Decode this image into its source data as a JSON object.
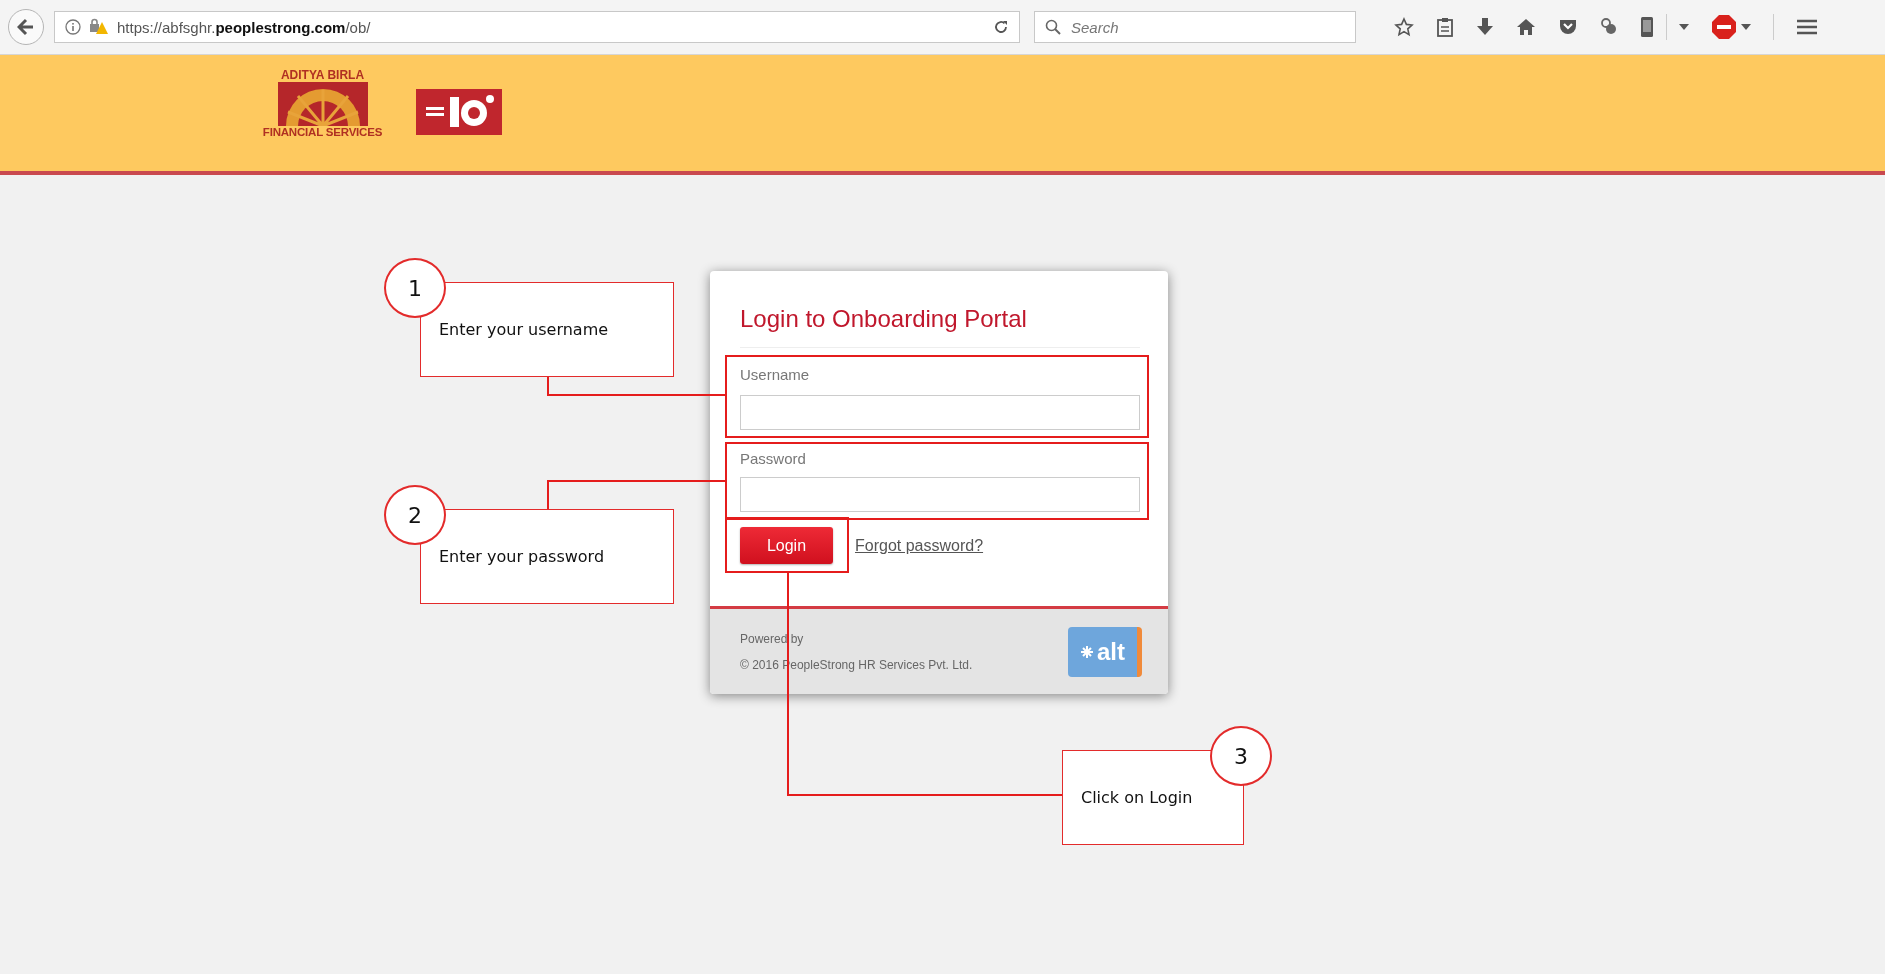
{
  "browser": {
    "url": "https://abfsghr.**peoplestrong.com**/ob/",
    "search_placeholder": "Search"
  },
  "header": {
    "logo_top": "ADITYA BIRLA",
    "logo_bottom": "FINANCIAL SERVICES"
  },
  "login": {
    "title": "Login to Onboarding Portal",
    "fields": [
      {
        "label": "Username"
      },
      {
        "label": "Password"
      }
    ],
    "button": "Login",
    "forgot_link": "Forgot password?",
    "powered_by": "Powered by",
    "copyright": "© 2016 PeopleStrong HR Services Pvt. Ltd.",
    "badge": "alt"
  },
  "callouts": [
    {
      "number": "1",
      "text": "Enter your username"
    },
    {
      "number": "2",
      "text": "Enter your password"
    },
    {
      "number": "3",
      "text": "Click on Login"
    }
  ]
}
